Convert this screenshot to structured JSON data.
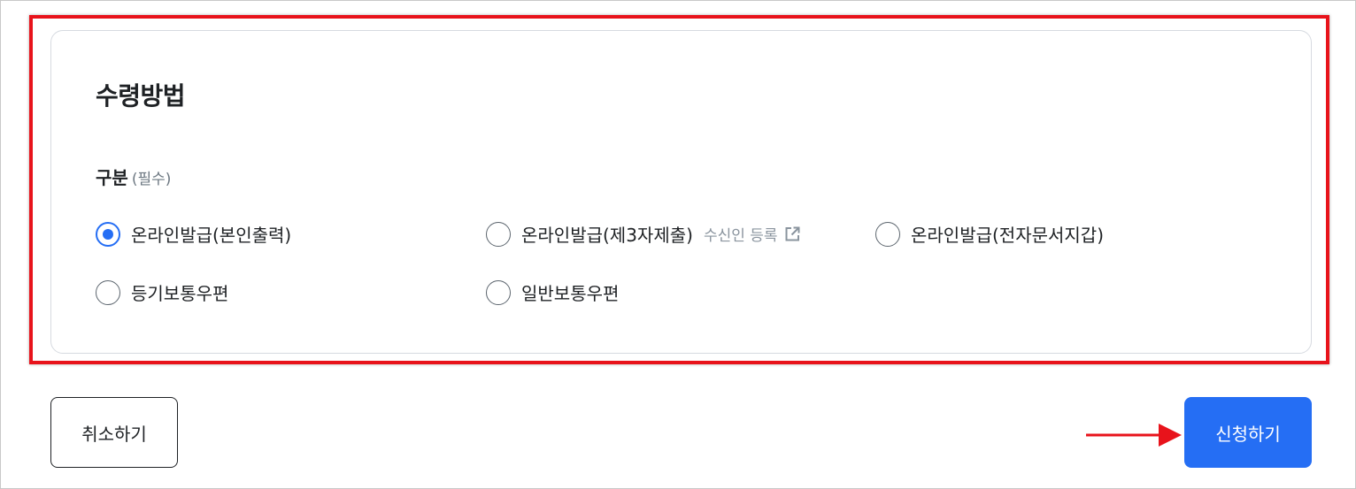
{
  "section": {
    "title": "수령방법",
    "field_label": "구분",
    "required_text": "(필수)"
  },
  "options": [
    {
      "label": "온라인발급(본인출력)",
      "checked": true
    },
    {
      "label": "온라인발급(제3자제출)",
      "checked": false,
      "sub_link": "수신인 등록",
      "sub_icon": "external-link-icon"
    },
    {
      "label": "온라인발급(전자문서지갑)",
      "checked": false
    },
    {
      "label": "등기보통우편",
      "checked": false
    },
    {
      "label": "일반보통우편",
      "checked": false
    }
  ],
  "buttons": {
    "cancel": "취소하기",
    "apply": "신청하기"
  },
  "colors": {
    "primary": "#256ef4",
    "highlight_border": "#e8131b",
    "annotation_arrow": "#e8131b",
    "text": "#1e2124",
    "muted": "#8a949e"
  }
}
